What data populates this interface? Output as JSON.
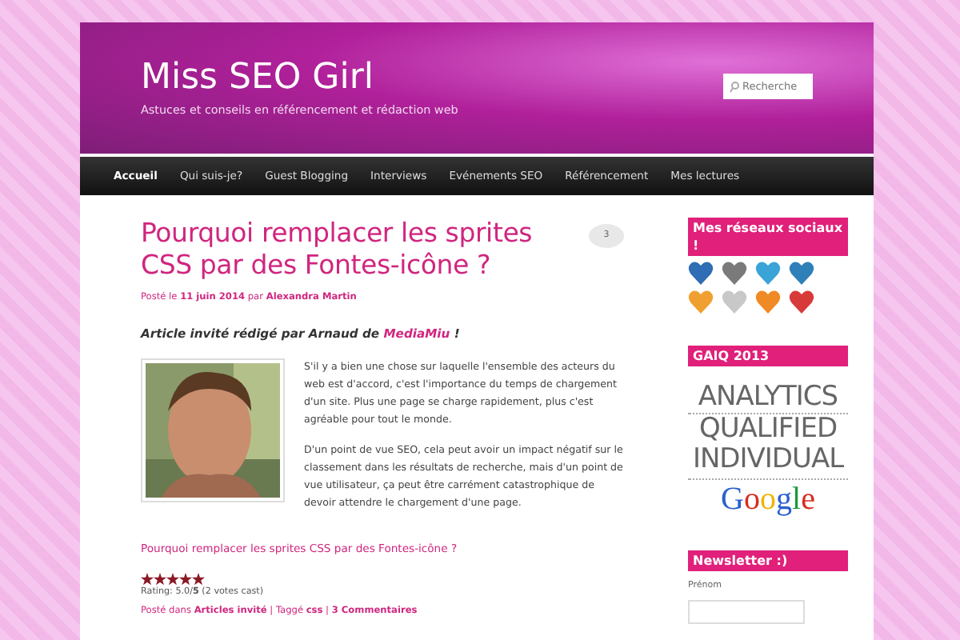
{
  "site": {
    "title": "Miss SEO Girl",
    "tagline": "Astuces et conseils en référencement et rédaction web",
    "search": {
      "placeholder": "Recherche"
    }
  },
  "nav": [
    {
      "label": "Accueil",
      "selected": true
    },
    {
      "label": "Qui suis-je?",
      "selected": false
    },
    {
      "label": "Guest Blogging",
      "selected": false
    },
    {
      "label": "Interviews",
      "selected": false
    },
    {
      "label": "Evénements SEO",
      "selected": false
    },
    {
      "label": "Référencement",
      "selected": false
    },
    {
      "label": "Mes lectures",
      "selected": false
    }
  ],
  "post": {
    "title": "Pourquoi remplacer les sprites CSS par des Fontes-icône ?",
    "comment_count": "3",
    "meta": [
      {
        "text": "Posté le ",
        "link": false
      },
      {
        "text": "11 juin 2014",
        "link": true
      },
      {
        "text": " par ",
        "link": false
      },
      {
        "text": "Alexandra Martin",
        "link": true
      }
    ],
    "intro": [
      {
        "text": "Article invité rédigé par Arnaud de ",
        "link": false
      },
      {
        "text": "MediaMiu",
        "link": true
      },
      {
        "text": " !",
        "link": false
      }
    ],
    "image": {
      "kind": "picture"
    },
    "paragraphs": [
      "S'il y a bien une chose sur laquelle l'ensemble des acteurs du web est d'accord, c'est l'importance du temps de chargement d'un site. Plus une page se charge rapidement, plus c'est agréable pour tout le monde.",
      "D'un point de vue SEO, cela peut avoir un impact négatif sur le classement dans les résultats de recherche, mais d'un point de vue utilisateur, ça peut être carrément catastrophique de devoir attendre le chargement d'une page."
    ],
    "read_more": "Pourquoi remplacer les sprites CSS par des Fontes-icône ?",
    "rating": {
      "stars": 5,
      "text": "Rating: 5.0/**5** (2 votes cast)"
    },
    "footer": [
      {
        "text": "Posté dans ",
        "link": false
      },
      {
        "text": "Articles invité",
        "link": true
      },
      {
        "text": " | Taggé ",
        "link": false
      },
      {
        "text": "css",
        "link": true
      },
      {
        "text": " | ",
        "link": false
      },
      {
        "text": "3 Commentaires",
        "link": true
      }
    ]
  },
  "sidebar": {
    "social": {
      "title": "Mes réseaux sociaux !",
      "icons": [
        {
          "color": "#2f6db5"
        },
        {
          "color": "#7a7a7a"
        },
        {
          "color": "#3aa3d8"
        },
        {
          "color": "#2f7fb8"
        },
        {
          "color": "#f0a030"
        },
        {
          "color": "#c8c8c8"
        },
        {
          "color": "#f08a24"
        },
        {
          "color": "#d83a3a"
        }
      ]
    },
    "gaiq": {
      "title": "GAIQ 2013",
      "lines": [
        "ANALYTICS",
        "QUALIFIED",
        "INDIVIDUAL"
      ],
      "brand": "Google"
    },
    "newsletter": {
      "title": "Newsletter :)",
      "field_label": "Prénom"
    }
  }
}
